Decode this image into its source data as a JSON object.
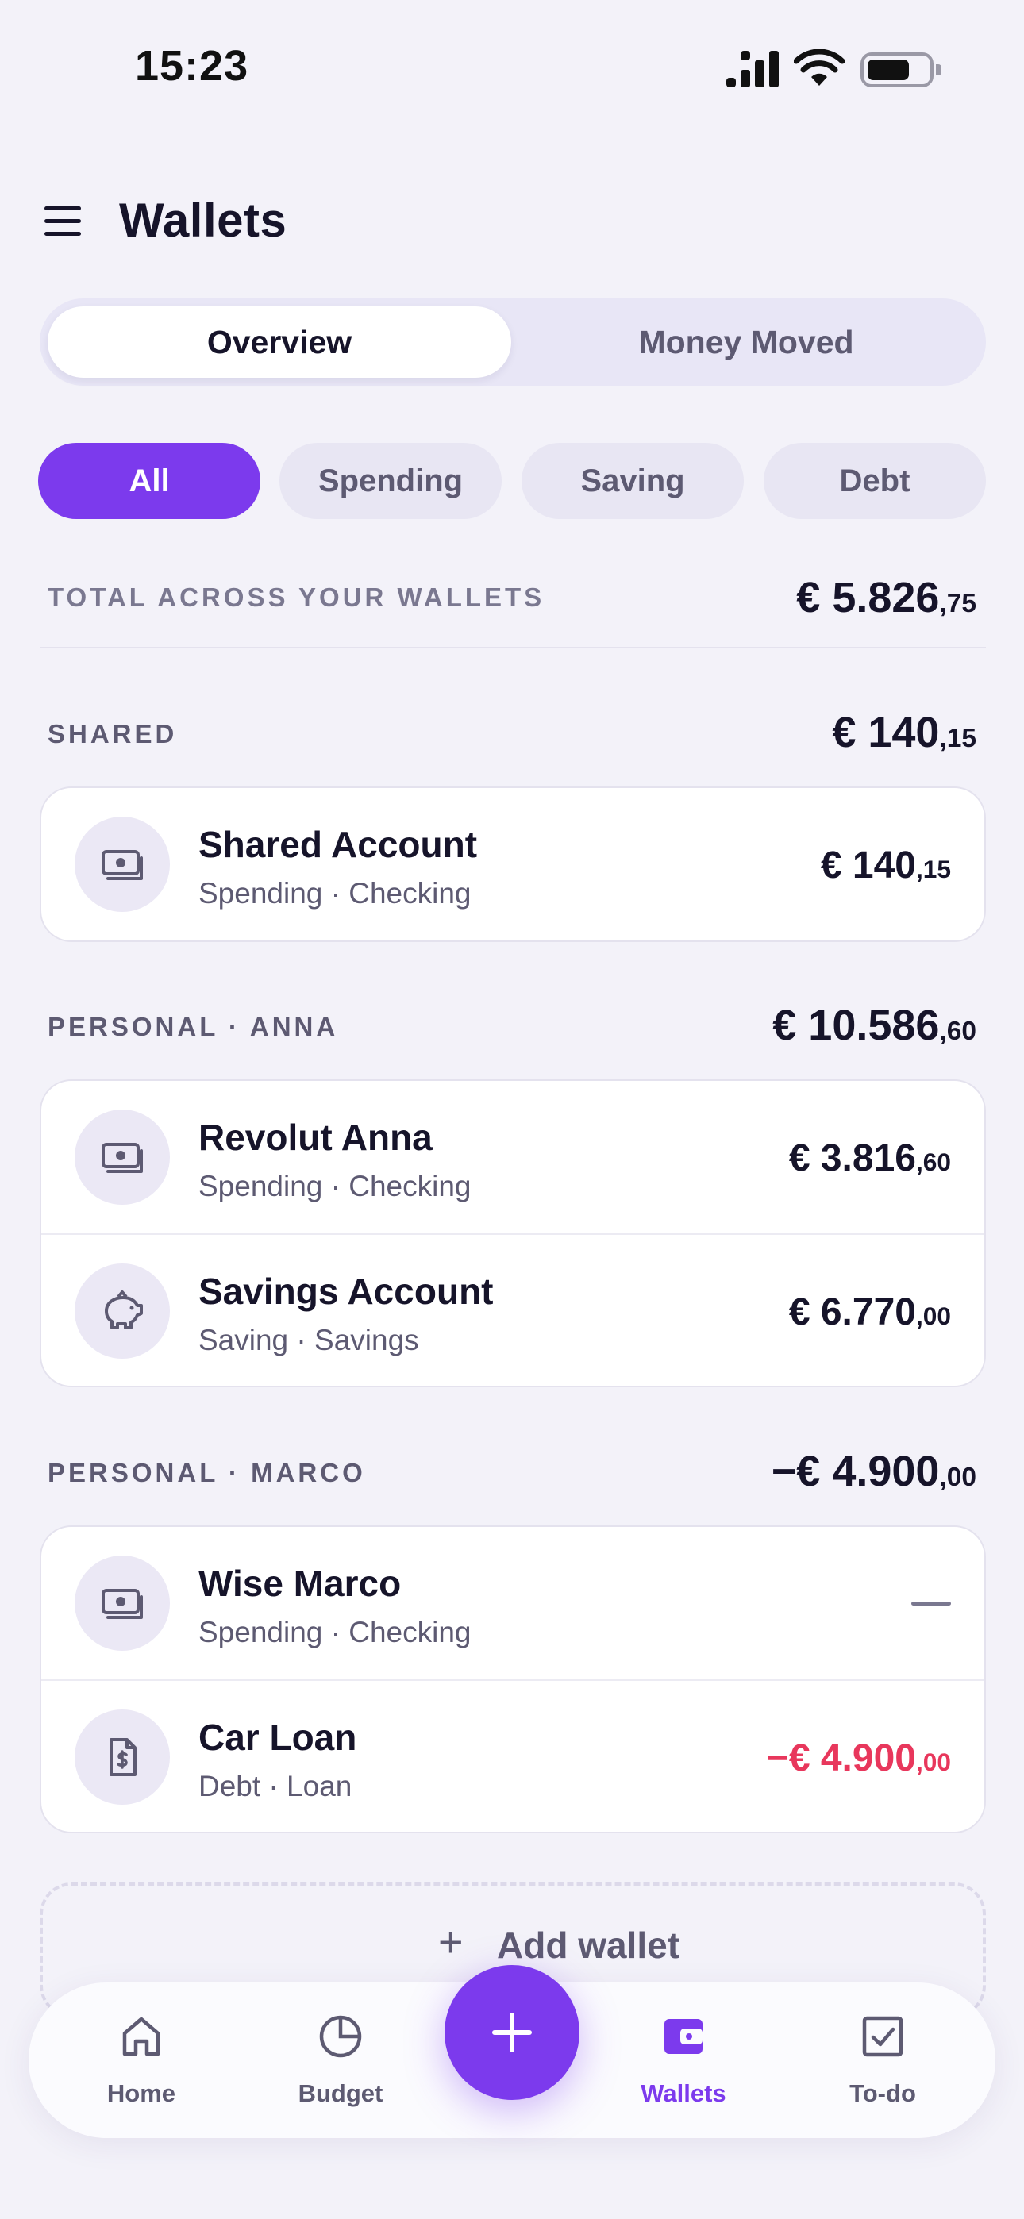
{
  "status_bar": {
    "time": "15:23"
  },
  "header": {
    "title": "Wallets"
  },
  "segmented": {
    "overview": "Overview",
    "money_moved": "Money Moved",
    "selected": "Overview"
  },
  "filters": {
    "all": "All",
    "spending": "Spending",
    "saving": "Saving",
    "debt": "Debt",
    "selected": "All"
  },
  "total": {
    "label": "TOTAL ACROSS YOUR WALLETS",
    "main": "€ 5.826",
    "cents": ",75"
  },
  "sections": {
    "shared": {
      "label": "SHARED",
      "total_main": "€ 140",
      "total_cents": ",15",
      "wallets": [
        {
          "name": "Shared Account",
          "sub": "Spending · Checking",
          "amount_main": "€ 140",
          "amount_cents": ",15",
          "icon": "cash-icon"
        }
      ]
    },
    "anna": {
      "label": "PERSONAL · ANNA",
      "total_main": "€ 10.586",
      "total_cents": ",60",
      "wallets": [
        {
          "name": "Revolut Anna",
          "sub": "Spending · Checking",
          "amount_main": "€ 3.816",
          "amount_cents": ",60",
          "icon": "cash-icon"
        },
        {
          "name": "Savings Account",
          "sub": "Saving · Savings",
          "amount_main": "€ 6.770",
          "amount_cents": ",00",
          "icon": "piggy-bank-icon"
        }
      ]
    },
    "marco": {
      "label": "PERSONAL · MARCO",
      "total_main": "−€ 4.900",
      "total_cents": ",00",
      "wallets": [
        {
          "name": "Wise Marco",
          "sub": "Spending · Checking",
          "amount_main": "",
          "amount_cents": "",
          "icon": "cash-icon"
        },
        {
          "name": "Car Loan",
          "sub": "Debt · Loan",
          "amount_main": "−€ 4.900",
          "amount_cents": ",00",
          "icon": "invoice-dollar-icon"
        }
      ]
    }
  },
  "add_wallet": {
    "label": "Add wallet"
  },
  "nav": {
    "home": "Home",
    "budget": "Budget",
    "wallets": "Wallets",
    "todo": "To-do",
    "active": "Wallets"
  },
  "colors": {
    "accent": "#7c3aed",
    "negative": "#e8375c",
    "background": "#f3f2f9"
  }
}
